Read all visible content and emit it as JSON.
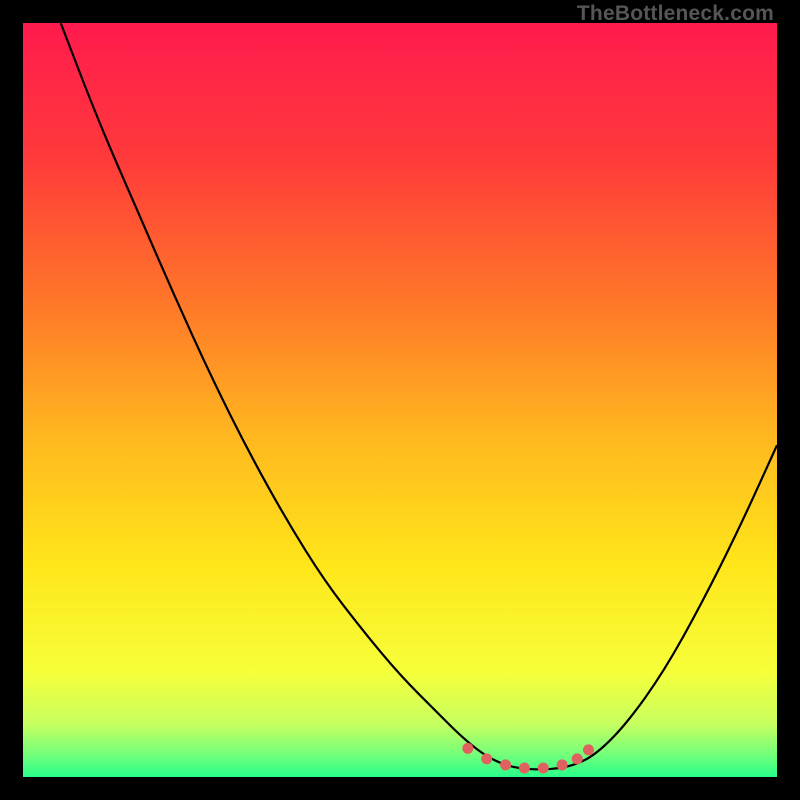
{
  "watermark": "TheBottleneck.com",
  "chart_data": {
    "type": "line",
    "title": "",
    "xlabel": "",
    "ylabel": "",
    "xlim": [
      0,
      100
    ],
    "ylim": [
      0,
      100
    ],
    "curve": [
      {
        "x": 5.0,
        "y": 100.0
      },
      {
        "x": 10.0,
        "y": 87.0
      },
      {
        "x": 15.0,
        "y": 75.5
      },
      {
        "x": 20.0,
        "y": 64.0
      },
      {
        "x": 25.0,
        "y": 53.0
      },
      {
        "x": 30.0,
        "y": 43.0
      },
      {
        "x": 35.0,
        "y": 34.0
      },
      {
        "x": 40.0,
        "y": 26.0
      },
      {
        "x": 45.0,
        "y": 19.5
      },
      {
        "x": 50.0,
        "y": 13.5
      },
      {
        "x": 55.0,
        "y": 8.5
      },
      {
        "x": 58.0,
        "y": 5.5
      },
      {
        "x": 61.0,
        "y": 3.0
      },
      {
        "x": 64.0,
        "y": 1.5
      },
      {
        "x": 67.0,
        "y": 1.0
      },
      {
        "x": 70.0,
        "y": 1.0
      },
      {
        "x": 73.0,
        "y": 1.5
      },
      {
        "x": 76.0,
        "y": 3.0
      },
      {
        "x": 80.0,
        "y": 7.0
      },
      {
        "x": 85.0,
        "y": 14.0
      },
      {
        "x": 90.0,
        "y": 23.0
      },
      {
        "x": 95.0,
        "y": 33.0
      },
      {
        "x": 100.0,
        "y": 44.0
      }
    ],
    "markers": [
      {
        "x": 59.0,
        "y": 3.8
      },
      {
        "x": 61.5,
        "y": 2.4
      },
      {
        "x": 64.0,
        "y": 1.6
      },
      {
        "x": 66.5,
        "y": 1.2
      },
      {
        "x": 69.0,
        "y": 1.2
      },
      {
        "x": 71.5,
        "y": 1.6
      },
      {
        "x": 73.5,
        "y": 2.4
      },
      {
        "x": 75.0,
        "y": 3.6
      }
    ],
    "gradient_stops": [
      {
        "pct": 0,
        "color": "#ff1a4e"
      },
      {
        "pct": 18,
        "color": "#ff3a3a"
      },
      {
        "pct": 38,
        "color": "#ff7a28"
      },
      {
        "pct": 55,
        "color": "#ffb81f"
      },
      {
        "pct": 72,
        "color": "#ffe61a"
      },
      {
        "pct": 86,
        "color": "#f6ff3a"
      },
      {
        "pct": 93,
        "color": "#c6ff60"
      },
      {
        "pct": 97,
        "color": "#74ff7a"
      },
      {
        "pct": 100,
        "color": "#28ff8a"
      }
    ],
    "marker_color": "#e16060",
    "curve_color": "#000000"
  }
}
